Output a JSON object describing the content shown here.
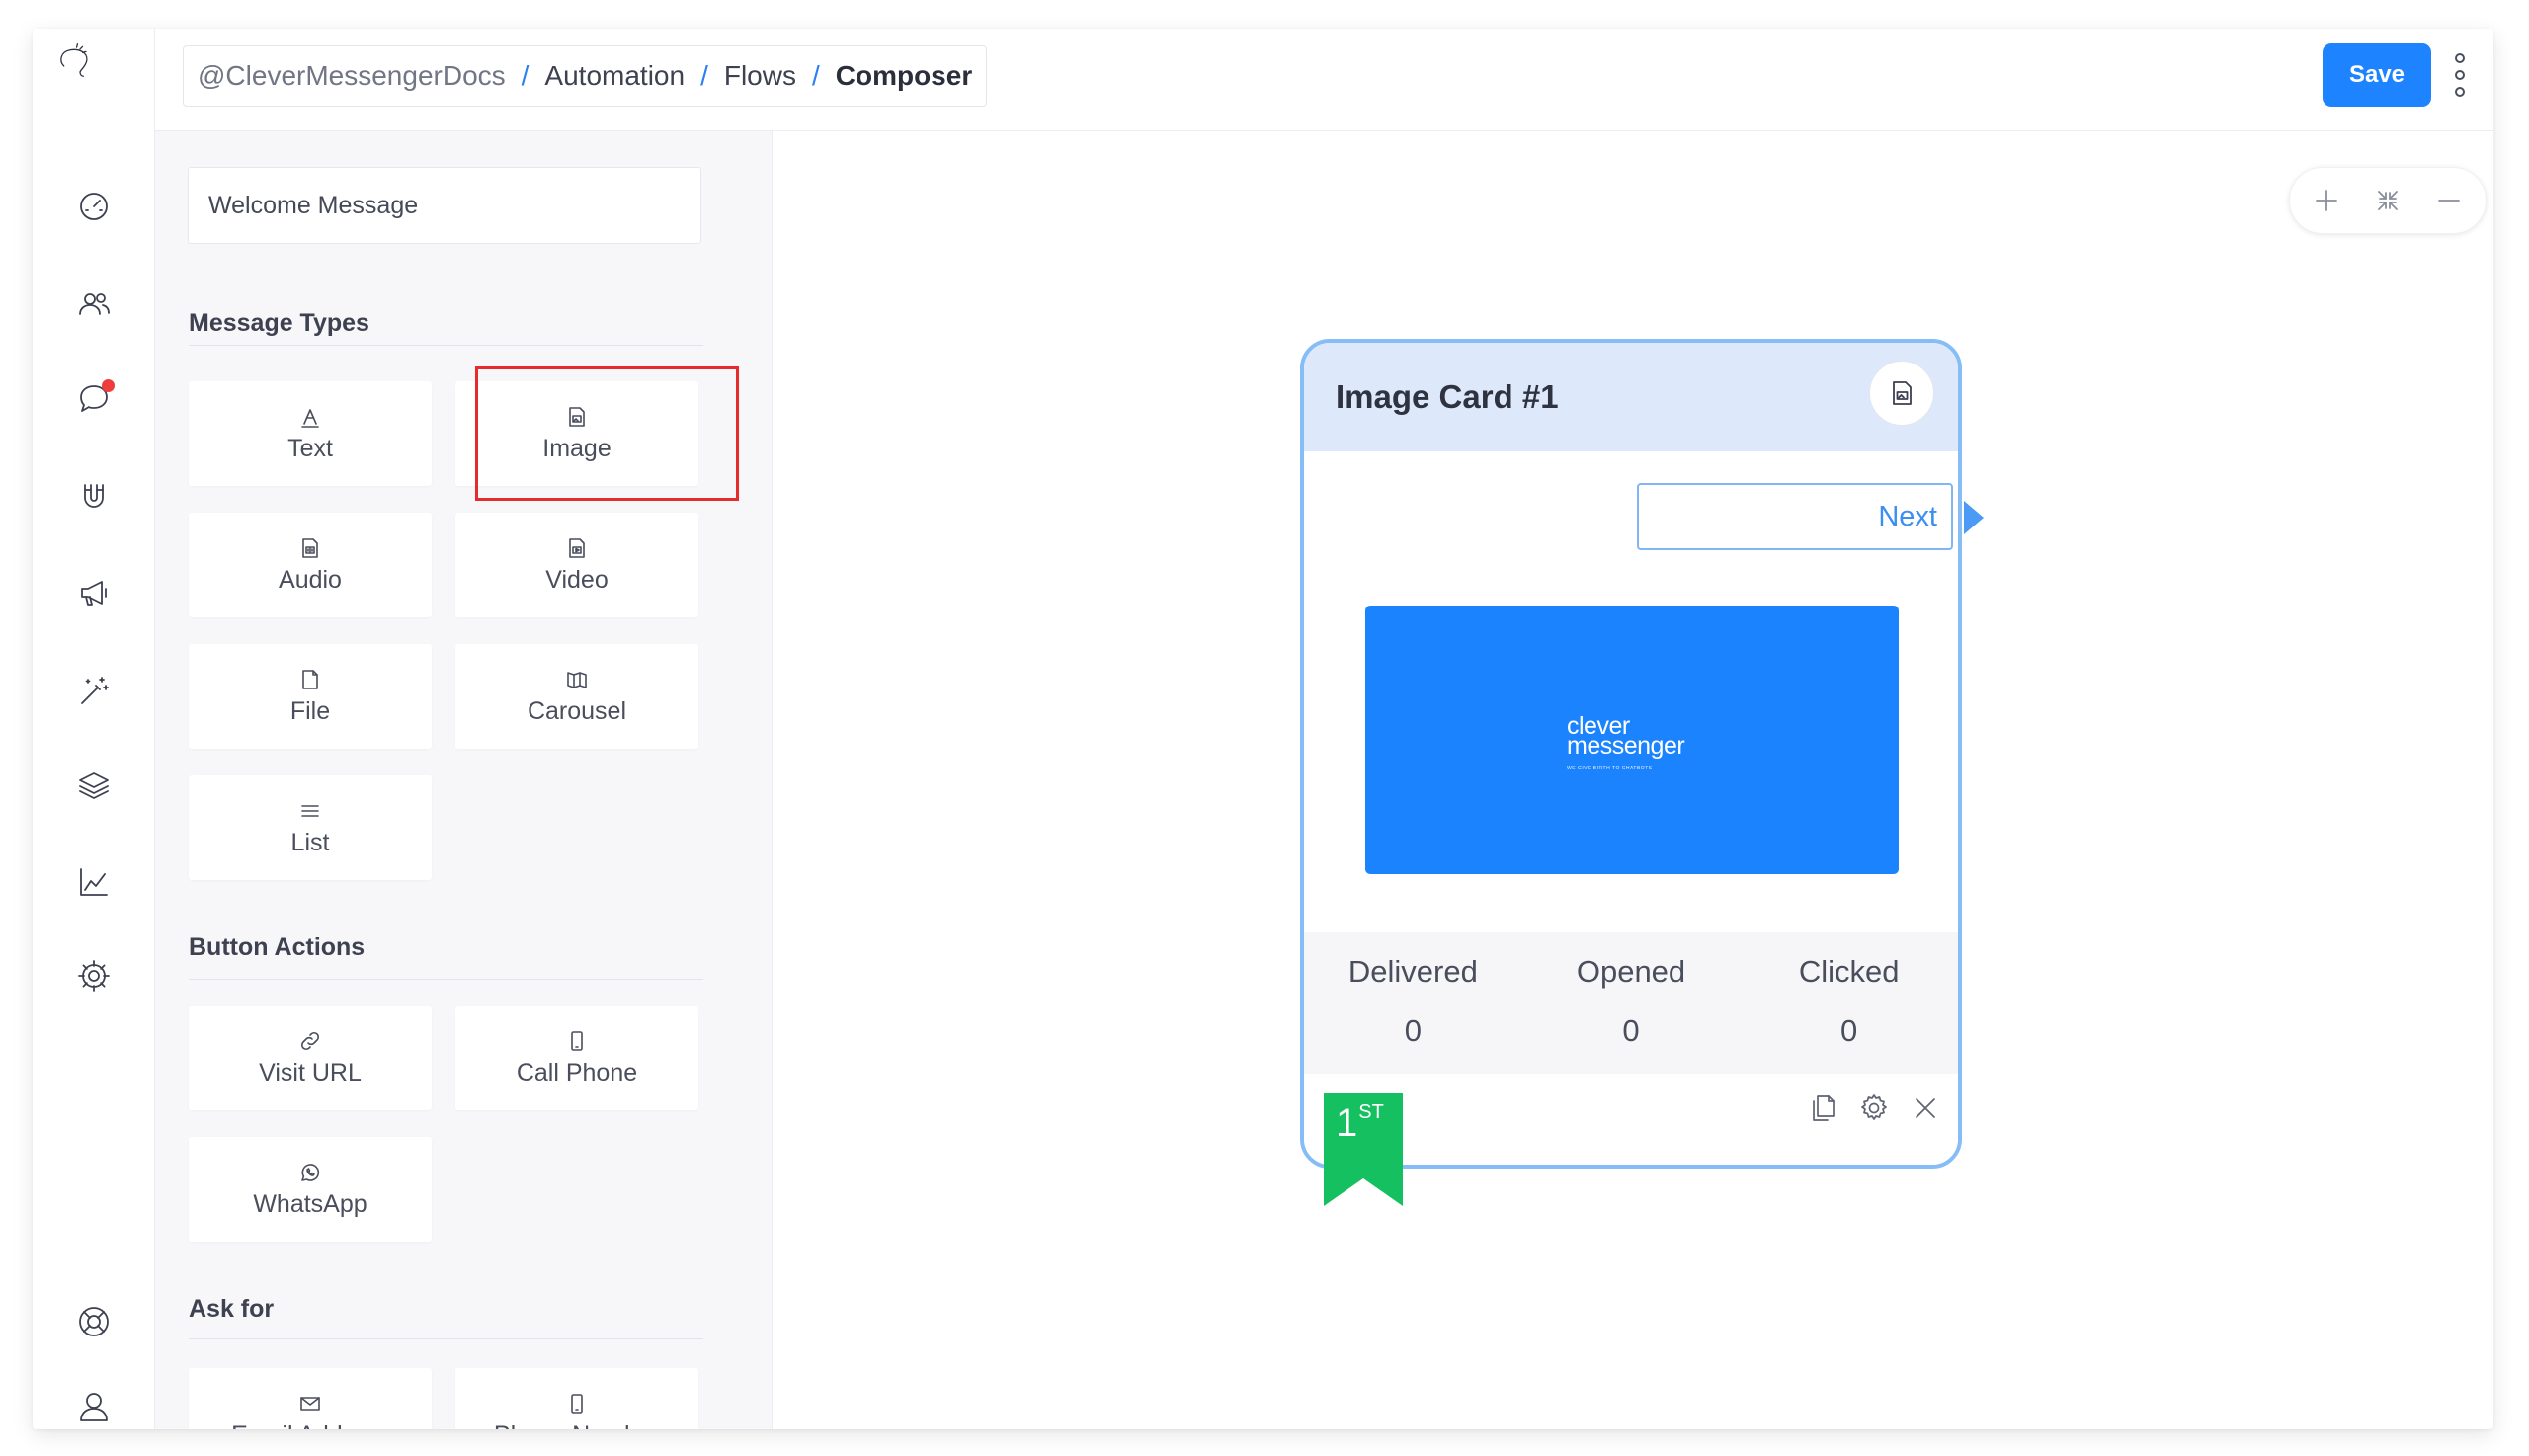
{
  "breadcrumb": {
    "items": [
      "@CleverMessengerDocs",
      "Automation",
      "Flows",
      "Composer"
    ],
    "separator": "/"
  },
  "header": {
    "save_label": "Save"
  },
  "sidebar": {
    "nav_icons": [
      "speedometer-icon",
      "users-icon",
      "chat-icon",
      "magnet-icon",
      "megaphone-icon",
      "magic-wand-icon",
      "layers-icon",
      "chart-icon",
      "settings-icon",
      "help-icon",
      "profile-icon"
    ],
    "notification_color": "#ef3d3d"
  },
  "panel": {
    "flow_name_value": "Welcome Message",
    "sections": {
      "message_types": {
        "title": "Message Types",
        "items": [
          {
            "label": "Text",
            "icon": "text-icon"
          },
          {
            "label": "Image",
            "icon": "image-icon"
          },
          {
            "label": "Audio",
            "icon": "audio-icon"
          },
          {
            "label": "Video",
            "icon": "video-icon"
          },
          {
            "label": "File",
            "icon": "file-icon"
          },
          {
            "label": "Carousel",
            "icon": "carousel-icon"
          },
          {
            "label": "List",
            "icon": "list-icon"
          }
        ]
      },
      "button_actions": {
        "title": "Button Actions",
        "items": [
          {
            "label": "Visit URL",
            "icon": "link-icon"
          },
          {
            "label": "Call Phone",
            "icon": "phone-icon"
          },
          {
            "label": "WhatsApp",
            "icon": "whatsapp-icon"
          }
        ]
      },
      "ask_for": {
        "title": "Ask for",
        "items": [
          {
            "label": "Email Address",
            "icon": "mail-icon"
          },
          {
            "label": "Phone Number",
            "icon": "phone-icon"
          }
        ]
      }
    }
  },
  "card": {
    "title": "Image Card #1",
    "next_label": "Next",
    "image_logo": {
      "line1": "clever",
      "line2": "messenger",
      "tagline": "WE GIVE BIRTH TO CHATBOTS"
    },
    "stats": [
      {
        "label": "Delivered",
        "value": "0"
      },
      {
        "label": "Opened",
        "value": "0"
      },
      {
        "label": "Clicked",
        "value": "0"
      }
    ],
    "badge": {
      "number": "1",
      "suffix": "ST"
    }
  },
  "colors": {
    "primary": "#1d83ff",
    "card_border": "#86bdf7",
    "card_header": "#dde9fb",
    "highlight": "#e52b2b",
    "badge": "#15c060"
  }
}
